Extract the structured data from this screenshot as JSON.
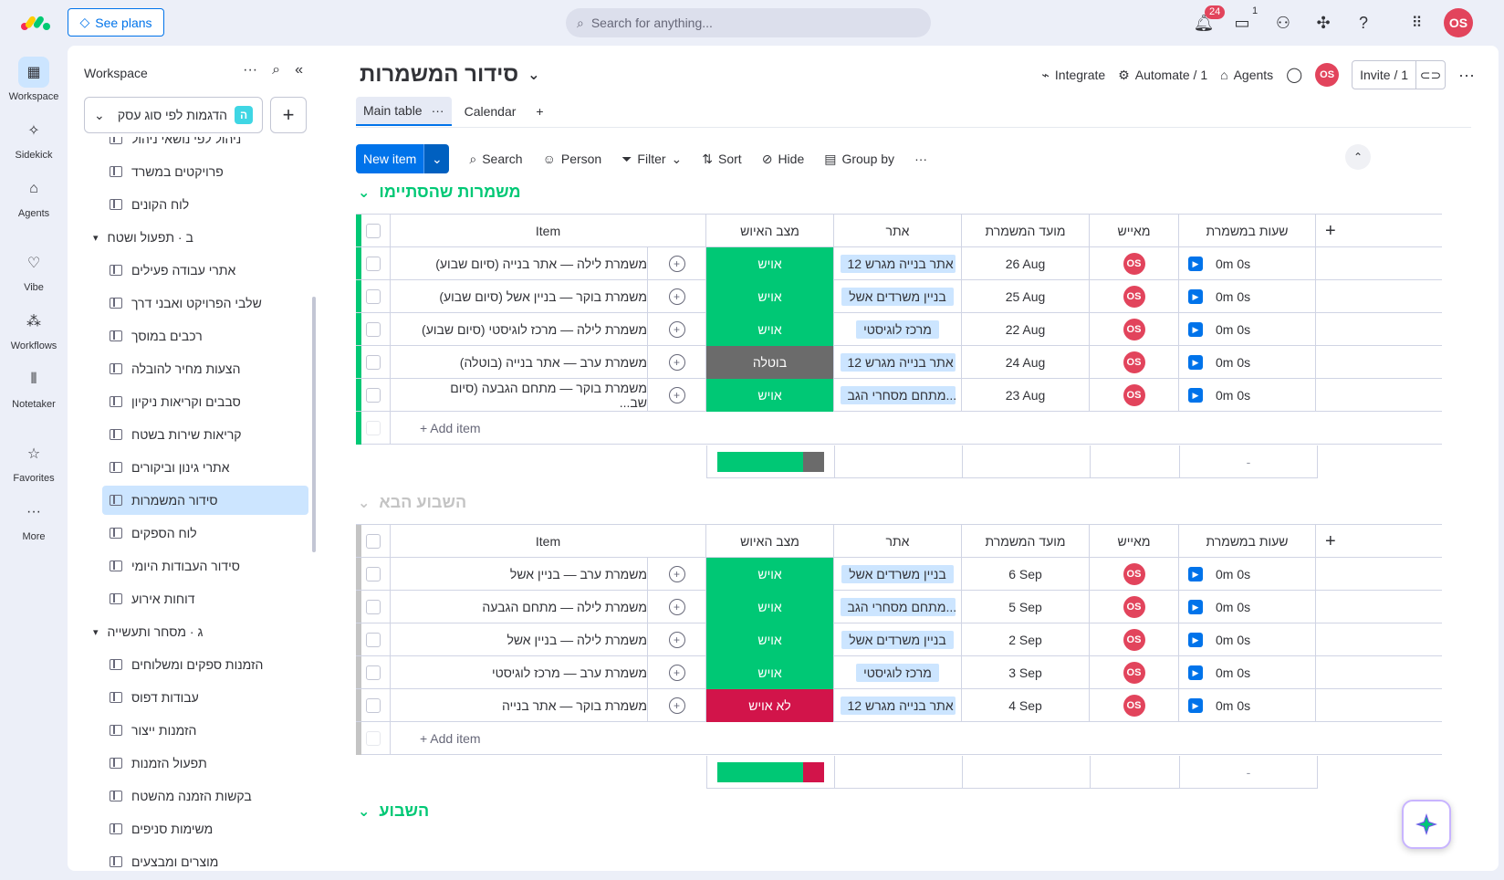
{
  "topbar": {
    "see_plans": "See plans",
    "search_placeholder": "Search for anything...",
    "notif_count": "24",
    "inbox_count": "1",
    "avatar": "OS"
  },
  "rail": [
    {
      "label": "Workspace",
      "icon": "grid-icon"
    },
    {
      "label": "Sidekick",
      "icon": "sparkle-icon"
    },
    {
      "label": "Agents",
      "icon": "agents-icon"
    },
    {
      "label": "Vibe",
      "icon": "heart-icon"
    },
    {
      "label": "Workflows",
      "icon": "workflows-icon"
    },
    {
      "label": "Notetaker",
      "icon": "waveform-icon"
    },
    {
      "label": "Favorites",
      "icon": "star-icon"
    },
    {
      "label": "More",
      "icon": "more-icon"
    }
  ],
  "sidebar": {
    "title": "Workspace",
    "workspace_name": "הדגמות לפי סוג עסק",
    "workspace_badge": "ה",
    "items": [
      {
        "label": "ניהול לפי נושאי ניהול",
        "type": "board"
      },
      {
        "label": "פרויקטים במשרד",
        "type": "board"
      },
      {
        "label": "לוח הקונים",
        "type": "board"
      },
      {
        "label": "ב · תפעול ושטח",
        "type": "folder"
      },
      {
        "label": "אתרי עבודה פעילים",
        "type": "board"
      },
      {
        "label": "שלבי הפרויקט ואבני דרך",
        "type": "board"
      },
      {
        "label": "רכבים במוסך",
        "type": "board"
      },
      {
        "label": "הצעות מחיר להובלה",
        "type": "board"
      },
      {
        "label": "סבבים וקריאות ניקיון",
        "type": "board"
      },
      {
        "label": "קריאות שירות בשטח",
        "type": "board"
      },
      {
        "label": "אתרי גינון וביקורים",
        "type": "board"
      },
      {
        "label": "סידור המשמרות",
        "type": "board",
        "active": true
      },
      {
        "label": "לוח הספקים",
        "type": "board"
      },
      {
        "label": "סידור העבודות היומי",
        "type": "board"
      },
      {
        "label": "דוחות אירוע",
        "type": "board"
      },
      {
        "label": "ג · מסחר ותעשייה",
        "type": "folder"
      },
      {
        "label": "הזמנות ספקים ומשלוחים",
        "type": "board"
      },
      {
        "label": "עבודות דפוס",
        "type": "board"
      },
      {
        "label": "הזמנות ייצור",
        "type": "board"
      },
      {
        "label": "תפעול הזמנות",
        "type": "board"
      },
      {
        "label": "בקשות הזמנה מהשטח",
        "type": "board"
      },
      {
        "label": "משימות סניפים",
        "type": "board"
      },
      {
        "label": "מוצרים ומבצעים",
        "type": "board"
      }
    ]
  },
  "board": {
    "title": "סידור המשמרות",
    "integrate": "Integrate",
    "automate": "Automate / 1",
    "agents": "Agents",
    "invite": "Invite / 1",
    "tabs": [
      "Main table",
      "Calendar"
    ],
    "toolbar": {
      "new_item": "New item",
      "search": "Search",
      "person": "Person",
      "filter": "Filter",
      "sort": "Sort",
      "hide": "Hide",
      "group_by": "Group by"
    },
    "columns": {
      "item": "Item",
      "status": "מצב האיוש",
      "site": "אתר",
      "date": "מועד המשמרת",
      "owner": "מאייש",
      "hours": "שעות במשמרת"
    },
    "add_item": "+ Add item",
    "summary_dash": "-"
  },
  "groups": [
    {
      "title": "משמרות שהסתיימו",
      "color": "#00c875",
      "rows": [
        {
          "item": "משמרת לילה — אתר בנייה (סיום שבוע)",
          "status": "אויש",
          "status_color": "#00c875",
          "site": "אתר בנייה מגרש 12",
          "date": "26 Aug",
          "owner": "OS",
          "hours": "0m 0s"
        },
        {
          "item": "משמרת בוקר — בניין אשל (סיום שבוע)",
          "status": "אויש",
          "status_color": "#00c875",
          "site": "בניין משרדים אשל",
          "date": "25 Aug",
          "owner": "OS",
          "hours": "0m 0s"
        },
        {
          "item": "משמרת לילה — מרכז לוגיסטי (סיום שבוע)",
          "status": "אויש",
          "status_color": "#00c875",
          "site": "מרכז לוגיסטי",
          "date": "22 Aug",
          "owner": "OS",
          "hours": "0m 0s"
        },
        {
          "item": "משמרת ערב — אתר בנייה (בוטלה)",
          "status": "בוטלה",
          "status_color": "#6b6b6b",
          "site": "אתר בנייה מגרש 12",
          "date": "24 Aug",
          "owner": "OS",
          "hours": "0m 0s"
        },
        {
          "item": "משמרת בוקר — מתחם הגבעה (סיום שב...",
          "status": "אויש",
          "status_color": "#00c875",
          "site": "מתחם מסחרי הגב...",
          "date": "23 Aug",
          "owner": "OS",
          "hours": "0m 0s"
        }
      ],
      "summary": [
        {
          "color": "#00c875",
          "fraction": 0.8
        },
        {
          "color": "#6b6b6b",
          "fraction": 0.2
        }
      ]
    },
    {
      "title": "השבוע הבא",
      "color": "#c4c4c4",
      "rows": [
        {
          "item": "משמרת ערב — בניין אשל",
          "status": "אויש",
          "status_color": "#00c875",
          "site": "בניין משרדים אשל",
          "date": "6 Sep",
          "owner": "OS",
          "hours": "0m 0s"
        },
        {
          "item": "משמרת לילה — מתחם הגבעה",
          "status": "אויש",
          "status_color": "#00c875",
          "site": "מתחם מסחרי הגב...",
          "date": "5 Sep",
          "owner": "OS",
          "hours": "0m 0s"
        },
        {
          "item": "משמרת לילה — בניין אשל",
          "status": "אויש",
          "status_color": "#00c875",
          "site": "בניין משרדים אשל",
          "date": "2 Sep",
          "owner": "OS",
          "hours": "0m 0s"
        },
        {
          "item": "משמרת ערב — מרכז לוגיסטי",
          "status": "אויש",
          "status_color": "#00c875",
          "site": "מרכז לוגיסטי",
          "date": "3 Sep",
          "owner": "OS",
          "hours": "0m 0s"
        },
        {
          "item": "משמרת בוקר — אתר בנייה",
          "status": "לא אויש",
          "status_color": "#d2144a",
          "site": "אתר בנייה מגרש 12",
          "date": "4 Sep",
          "owner": "OS",
          "hours": "0m 0s"
        }
      ],
      "summary": [
        {
          "color": "#00c875",
          "fraction": 0.8
        },
        {
          "color": "#d2144a",
          "fraction": 0.2
        }
      ]
    },
    {
      "title": "השבוע",
      "color": "#00c875",
      "rows": []
    }
  ]
}
